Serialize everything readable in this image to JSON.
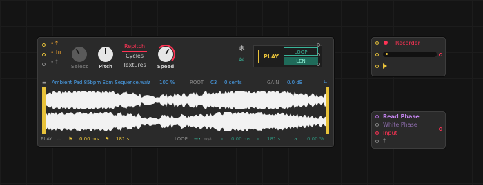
{
  "sampler": {
    "knobs": {
      "select": "Select",
      "pitch": "Pitch",
      "speed": "Speed"
    },
    "modes": [
      "Repitch",
      "Cycles",
      "Textures"
    ],
    "play_btn": "PLAY",
    "loop_btn": "LOOP",
    "len_btn": "LEN",
    "info": {
      "file": "Ambient Pad 85bpm Ebm Sequence.wav",
      "zoom": "100 %",
      "root_label": "ROOT",
      "root_note": "C3",
      "cents": "0 cents",
      "gain_label": "GAIN",
      "gain_value": "0.0 dB"
    },
    "bottom": {
      "play_label": "PLAY",
      "start": "0.00 ms",
      "end": "181 s",
      "loop_label": "LOOP",
      "loop_start": "0.00 ms",
      "loop_end": "181 s",
      "loop_fade": "0.00 %"
    }
  },
  "recorder": {
    "title": "Recorder"
  },
  "phase": {
    "read_phase": "Read Phase",
    "write_phase": "White Phase",
    "input": "Input",
    "extra": "†"
  },
  "colors": {
    "yellow": "#e8c23a",
    "red": "#ff3355",
    "teal": "#3ab59a",
    "blue": "#4aa3f0",
    "purple": "#b06ad8"
  }
}
